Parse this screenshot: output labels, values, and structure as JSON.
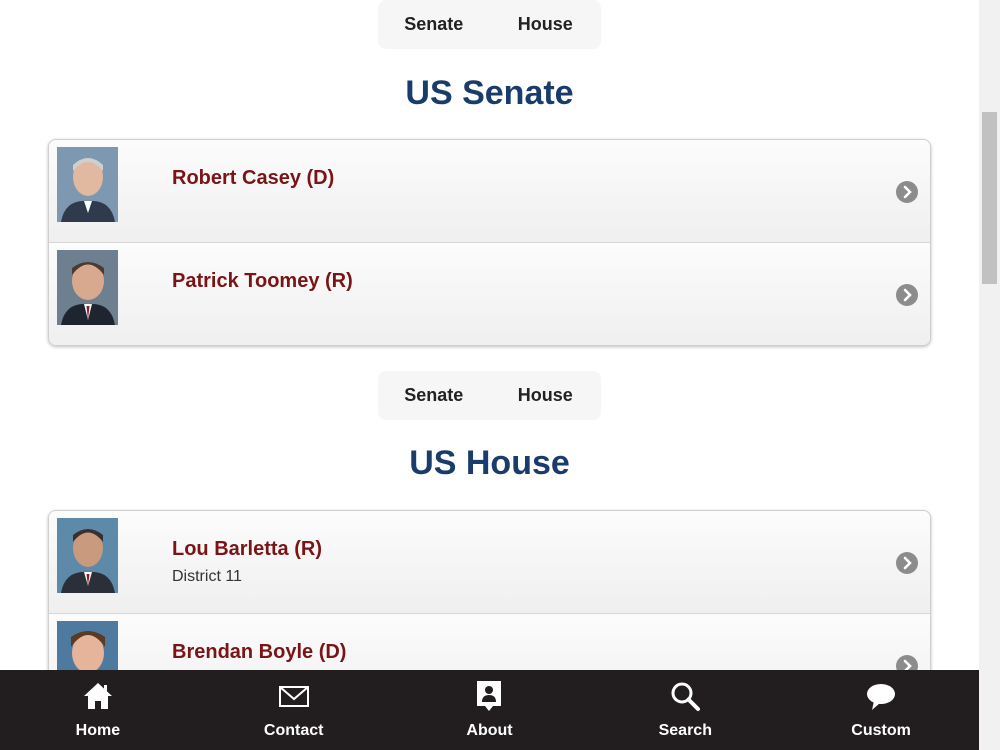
{
  "senate_nav": {
    "senate": "Senate",
    "house": "House"
  },
  "senate": {
    "title": "US Senate",
    "members": [
      {
        "name": "Robert Casey (D)"
      },
      {
        "name": "Patrick Toomey (R)"
      }
    ]
  },
  "house_nav": {
    "senate": "Senate",
    "house": "House"
  },
  "house": {
    "title": "US House",
    "members": [
      {
        "name": "Lou Barletta (R)",
        "district": "District 11"
      },
      {
        "name": "Brendan Boyle (D)"
      }
    ]
  },
  "tabbar": {
    "items": [
      {
        "label": "Home",
        "icon": "home-icon"
      },
      {
        "label": "Contact",
        "icon": "envelope-icon"
      },
      {
        "label": "About",
        "icon": "person-badge-icon"
      },
      {
        "label": "Search",
        "icon": "search-icon"
      },
      {
        "label": "Custom",
        "icon": "speech-bubble-icon"
      }
    ]
  },
  "colors": {
    "title": "#1a3c6a",
    "name": "#7a1416",
    "tabbar": "#221e1f"
  }
}
